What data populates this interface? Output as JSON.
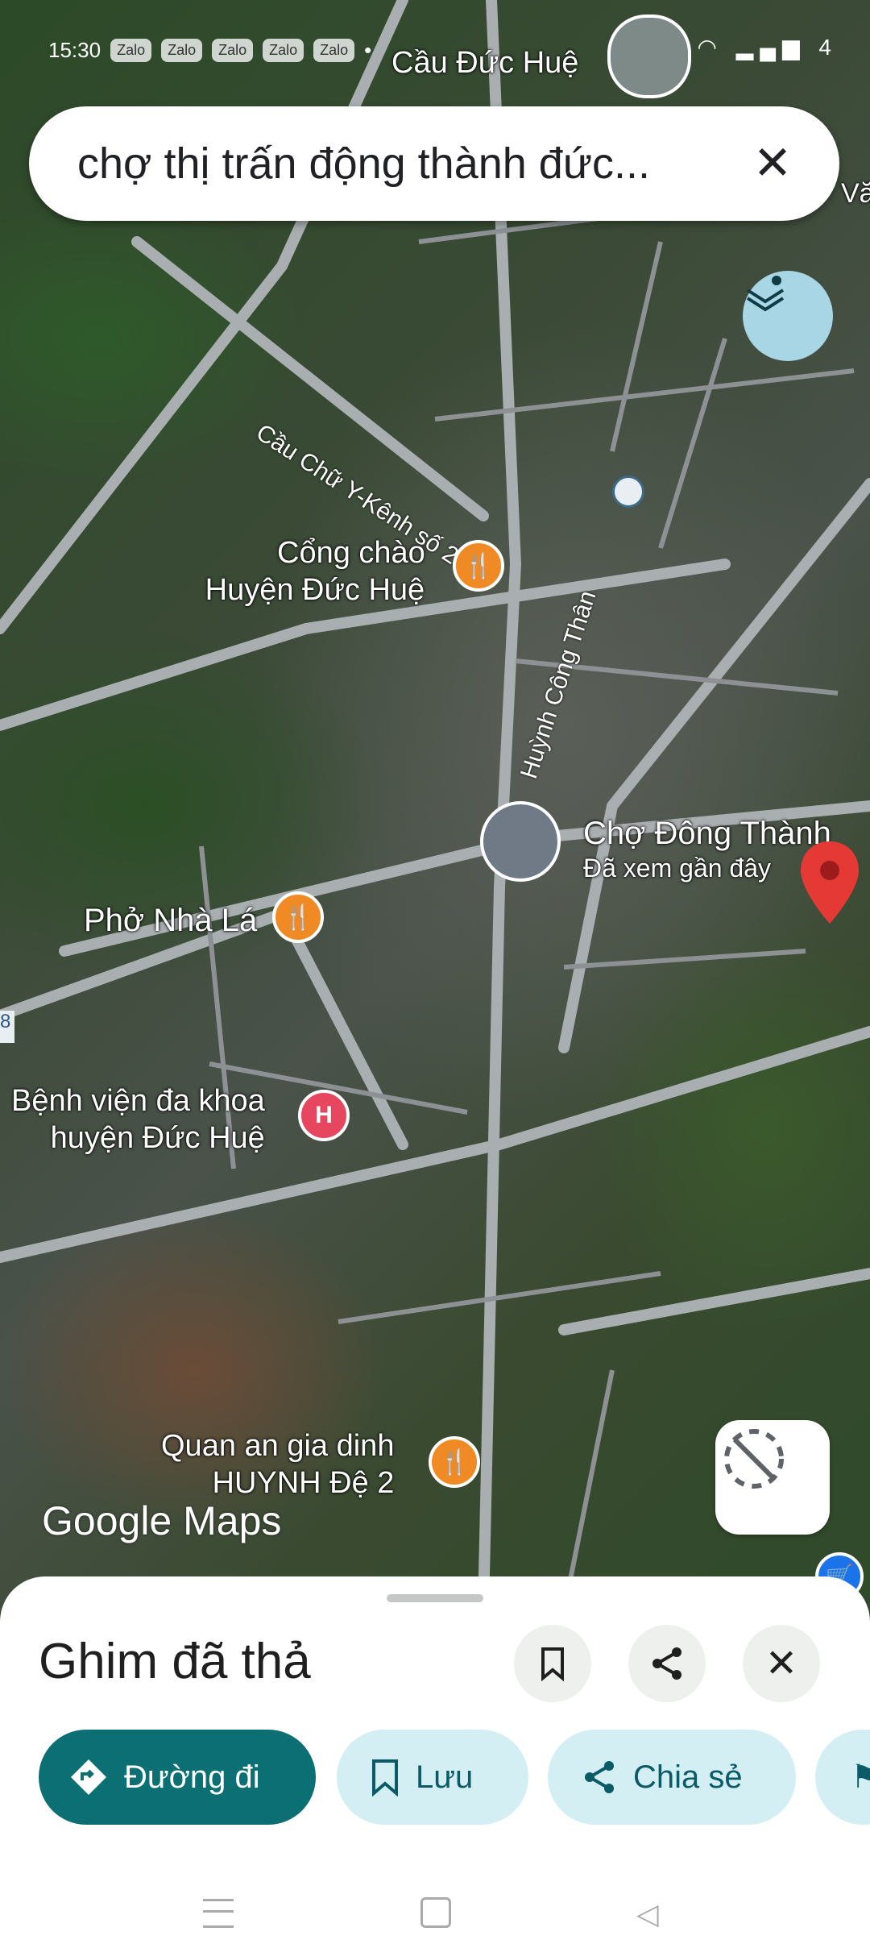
{
  "status_bar": {
    "time": "15:30",
    "notification_chips": [
      "Zalo",
      "Zalo",
      "Zalo",
      "Zalo",
      "Zalo"
    ],
    "signal_text": "4"
  },
  "search": {
    "query": "chợ thị trấn động thành đức...",
    "close_icon": "close-icon"
  },
  "map": {
    "top_label": "Cầu Đức Huệ",
    "edge_label": "Vă",
    "road_labels": [
      "Cầu Chữ Y-Kênh số 2",
      "Huỳnh Công Thân"
    ],
    "places": [
      {
        "name_line1": "Cổng chào",
        "name_line2": "Huyện Đức Huệ",
        "icon": "restaurant-icon"
      },
      {
        "name_line1": "Chợ Đông Thành",
        "name_line2": "Đã xem gần đây",
        "icon": "photo-thumbnail"
      },
      {
        "name_line1": "Phở Nhà Lá",
        "name_line2": "",
        "icon": "restaurant-icon"
      },
      {
        "name_line1": "Bệnh viện đa khoa",
        "name_line2": "huyện Đức Huệ",
        "icon": "hospital-icon"
      },
      {
        "name_line1": "Quan an gia dinh",
        "name_line2": "HUYNH Đệ 2",
        "icon": "restaurant-icon"
      }
    ],
    "edge_marker": "8",
    "logo": "Google Maps",
    "pin_color": "#e53935",
    "restaurant_color": "#f08a24",
    "hospital_color": "#e7475e"
  },
  "sheet": {
    "title": "Ghim đã thả",
    "actions": [
      {
        "label": "Đường đi",
        "icon": "directions-icon"
      },
      {
        "label": "Lưu",
        "icon": "bookmark-icon"
      },
      {
        "label": "Chia sẻ",
        "icon": "share-icon"
      }
    ],
    "accent": "#0b6f73"
  }
}
